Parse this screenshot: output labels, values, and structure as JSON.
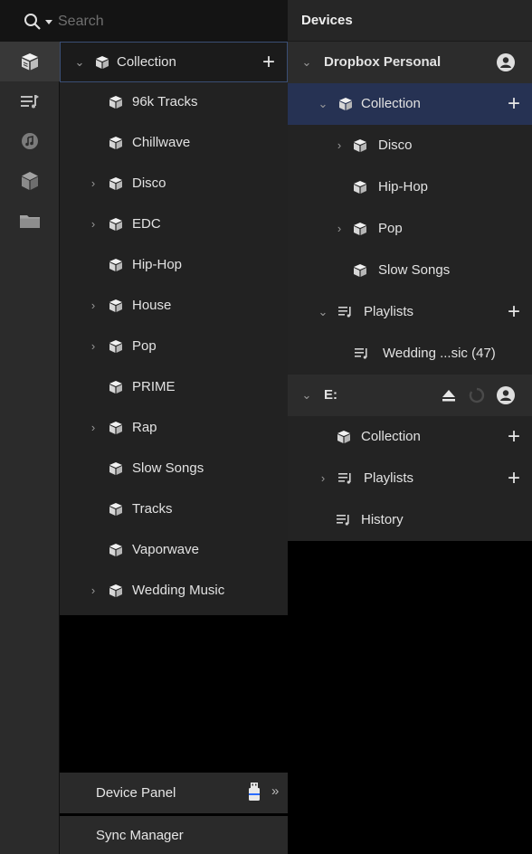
{
  "search": {
    "placeholder": "Search"
  },
  "rail": {
    "icons": [
      "crate-icon",
      "playlists-icon",
      "music-icon",
      "box-icon",
      "folder-icon"
    ]
  },
  "library": {
    "items": [
      {
        "label": "Collection",
        "expandable": true,
        "expanded": true,
        "selected": true,
        "addable": true
      },
      {
        "label": "96k Tracks"
      },
      {
        "label": "Chillwave"
      },
      {
        "label": "Disco",
        "expandable": true
      },
      {
        "label": "EDC",
        "expandable": true
      },
      {
        "label": "Hip-Hop"
      },
      {
        "label": "House",
        "expandable": true
      },
      {
        "label": "Pop",
        "expandable": true
      },
      {
        "label": "PRIME"
      },
      {
        "label": "Rap",
        "expandable": true
      },
      {
        "label": "Slow Songs"
      },
      {
        "label": "Tracks"
      },
      {
        "label": "Vaporwave"
      },
      {
        "label": "Wedding Music",
        "expandable": true
      }
    ]
  },
  "bottom": {
    "device_panel": "Device Panel",
    "sync_manager": "Sync Manager"
  },
  "devices": {
    "title": "Devices",
    "dropbox": {
      "name": "Dropbox Personal",
      "collection": "Collection",
      "crates": [
        "Disco",
        "Hip-Hop",
        "Pop",
        "Slow Songs"
      ],
      "playlists": "Playlists",
      "playlist_items": [
        "Wedding ...sic (47)"
      ]
    },
    "drive_e": {
      "name": "E:",
      "collection": "Collection",
      "playlists": "Playlists",
      "history": "History"
    }
  },
  "colors": {
    "selection_border": "#3a4e74",
    "device_selection": "#263253",
    "panel_bg": "#222222"
  }
}
